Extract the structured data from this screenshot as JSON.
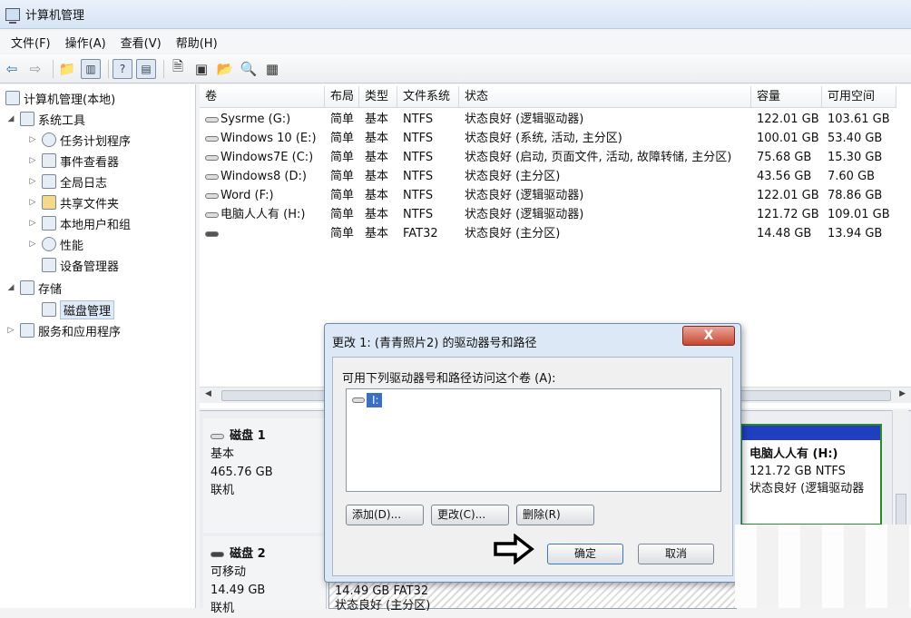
{
  "window": {
    "title": "计算机管理"
  },
  "menu": [
    "文件(F)",
    "操作(A)",
    "查看(V)",
    "帮助(H)"
  ],
  "tree": {
    "root": "计算机管理(本地)",
    "system_tools": "系统工具",
    "task_scheduler": "任务计划程序",
    "event_viewer": "事件查看器",
    "shared_folders_log": "全局日志",
    "shared_folders": "共享文件夹",
    "local_users": "本地用户和组",
    "performance": "性能",
    "device_manager": "设备管理器",
    "storage": "存储",
    "disk_management": "磁盘管理",
    "services": "服务和应用程序"
  },
  "volumes": {
    "headers": [
      "卷",
      "布局",
      "类型",
      "文件系统",
      "状态",
      "容量",
      "可用空间"
    ],
    "rows": [
      [
        "Sysrme (G:)",
        "简单",
        "基本",
        "NTFS",
        "状态良好 (逻辑驱动器)",
        "122.01 GB",
        "103.61 GB"
      ],
      [
        "Windows 10 (E:)",
        "简单",
        "基本",
        "NTFS",
        "状态良好 (系统, 活动, 主分区)",
        "100.01 GB",
        "53.40 GB"
      ],
      [
        "Windows7E (C:)",
        "简单",
        "基本",
        "NTFS",
        "状态良好 (启动, 页面文件, 活动, 故障转储, 主分区)",
        "75.68 GB",
        "15.30 GB"
      ],
      [
        "Windows8 (D:)",
        "简单",
        "基本",
        "NTFS",
        "状态良好 (主分区)",
        "43.56 GB",
        "7.60 GB"
      ],
      [
        "Word (F:)",
        "简单",
        "基本",
        "NTFS",
        "状态良好 (逻辑驱动器)",
        "122.01 GB",
        "78.86 GB"
      ],
      [
        "电脑人人有 (H:)",
        "简单",
        "基本",
        "NTFS",
        "状态良好 (逻辑驱动器)",
        "121.72 GB",
        "109.01 GB"
      ],
      [
        "",
        "简单",
        "基本",
        "FAT32",
        "状态良好 (主分区)",
        "14.48 GB",
        "13.94 GB"
      ]
    ]
  },
  "disks": {
    "disk1": {
      "name": "磁盘 1",
      "type": "基本",
      "size": "465.76 GB",
      "status": "联机"
    },
    "disk2": {
      "name": "磁盘 2",
      "type": "可移动",
      "size": "14.49 GB",
      "status": "联机"
    },
    "disk1_part_h": {
      "name": "电脑人人有 (H:)",
      "size": "121.72 GB NTFS",
      "status": "状态良好 (逻辑驱动器"
    },
    "disk2_part": {
      "size": "14.49 GB FAT32",
      "status": "状态良好 (主分区)"
    }
  },
  "dialog": {
    "title": "更改 1: (青青照片2) 的驱动器号和路径",
    "close": "X",
    "prompt": "可用下列驱动器号和路径访问这个卷 (A):",
    "list_items": [
      "I:"
    ],
    "add": "添加(D)...",
    "change": "更改(C)...",
    "remove": "删除(R)",
    "ok": "确定",
    "cancel": "取消"
  },
  "colors": {
    "dialog_bg": "#dce8f5",
    "selection": "#3a6fc4",
    "close_button": "#c9462f",
    "partition_bar": "#1f3fbf"
  }
}
